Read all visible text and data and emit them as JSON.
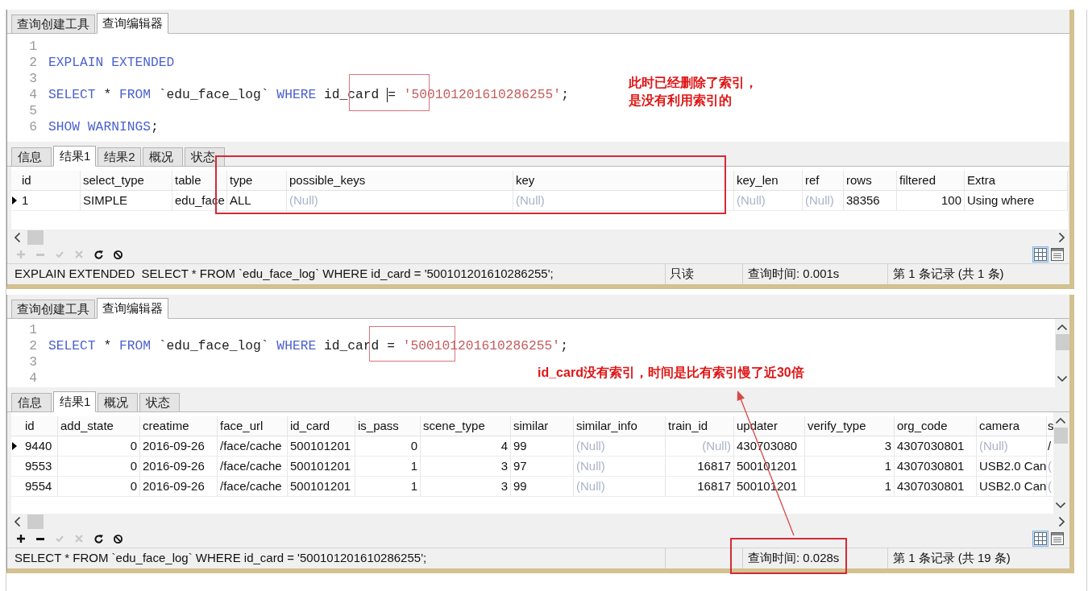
{
  "panes": [
    {
      "editor_tabs": [
        {
          "label": "查询创建工具",
          "selected": false
        },
        {
          "label": "查询编辑器",
          "selected": true
        }
      ],
      "code_lines": [
        {
          "number": "1"
        },
        {
          "number": "2",
          "tokens": [
            {
              "kind": "keyword",
              "text": "EXPLAIN EXTENDED"
            }
          ]
        },
        {
          "number": "3"
        },
        {
          "number": "4",
          "tokens": [
            {
              "kind": "keyword",
              "text": "SELECT"
            },
            {
              "kind": "plain",
              "text": " * "
            },
            {
              "kind": "keyword",
              "text": "FROM"
            },
            {
              "kind": "plain",
              "text": " `edu_face_log` "
            },
            {
              "kind": "keyword",
              "text": "WHERE"
            },
            {
              "kind": "plain",
              "text": " id_card "
            },
            {
              "kind": "caret"
            },
            {
              "kind": "plain",
              "text": "= "
            },
            {
              "kind": "string",
              "text": "'500101201610286255'"
            },
            {
              "kind": "plain",
              "text": ";"
            }
          ]
        },
        {
          "number": "5"
        },
        {
          "number": "6",
          "tokens": [
            {
              "kind": "keyword",
              "text": "SHOW WARNINGS"
            },
            {
              "kind": "plain",
              "text": ";"
            }
          ]
        }
      ],
      "editor_scrollbar": false,
      "annotation": {
        "lines": [
          "此时已经删除了索引，",
          "是没有利用索引的"
        ]
      },
      "result_tabs": [
        {
          "label": "信息",
          "selected": false
        },
        {
          "label": "结果1",
          "selected": true
        },
        {
          "label": "结果2",
          "selected": false
        },
        {
          "label": "概况",
          "selected": false
        },
        {
          "label": "状态",
          "selected": false
        }
      ],
      "table": {
        "columns": [
          {
            "label": "id",
            "kind": "text"
          },
          {
            "label": "select_type",
            "kind": "text"
          },
          {
            "label": "table",
            "kind": "text"
          },
          {
            "label": "type",
            "kind": "text"
          },
          {
            "label": "possible_keys",
            "kind": "text"
          },
          {
            "label": "key",
            "kind": "text"
          },
          {
            "label": "key_len",
            "kind": "text"
          },
          {
            "label": "ref",
            "kind": "text"
          },
          {
            "label": "rows",
            "kind": "text"
          },
          {
            "label": "filtered",
            "kind": "number"
          },
          {
            "label": "Extra",
            "kind": "text"
          }
        ],
        "rows": [
          {
            "selected": true,
            "cells": [
              {
                "text": "1",
                "null": false
              },
              {
                "text": "SIMPLE",
                "null": false
              },
              {
                "text": "edu_face",
                "null": false
              },
              {
                "text": "ALL",
                "null": false
              },
              {
                "text": "(Null)",
                "null": true
              },
              {
                "text": "(Null)",
                "null": true
              },
              {
                "text": "(Null)",
                "null": true
              },
              {
                "text": "(Null)",
                "null": true
              },
              {
                "text": "38356",
                "null": false
              },
              {
                "text": "100",
                "null": false
              },
              {
                "text": "Using where",
                "null": false
              }
            ]
          }
        ]
      },
      "table_scrollbar": false,
      "toolbar": [
        {
          "kind": "add",
          "disabled": true
        },
        {
          "kind": "remove",
          "disabled": true
        },
        {
          "kind": "apply",
          "disabled": true
        },
        {
          "kind": "discard",
          "disabled": true
        },
        {
          "kind": "refresh",
          "disabled": false
        },
        {
          "kind": "stop",
          "disabled": false
        }
      ],
      "view_toggles": [
        {
          "kind": "grid",
          "selected": true
        },
        {
          "kind": "form",
          "selected": false
        }
      ],
      "status_bar": {
        "sql": "EXPLAIN EXTENDED  SELECT * FROM `edu_face_log` WHERE id_card = '500101201610286255';",
        "mode": "只读",
        "query_time": "查询时间: 0.001s",
        "record": "第 1 条记录 (共 1 条)"
      }
    },
    {
      "editor_tabs": [
        {
          "label": "查询创建工具",
          "selected": false
        },
        {
          "label": "查询编辑器",
          "selected": true
        }
      ],
      "code_lines": [
        {
          "number": "1"
        },
        {
          "number": "2",
          "tokens": [
            {
              "kind": "keyword",
              "text": "SELECT"
            },
            {
              "kind": "plain",
              "text": " * "
            },
            {
              "kind": "keyword",
              "text": "FROM"
            },
            {
              "kind": "plain",
              "text": " `edu_face_log` "
            },
            {
              "kind": "keyword",
              "text": "WHERE"
            },
            {
              "kind": "plain",
              "text": " id_card = "
            },
            {
              "kind": "string",
              "text": "'500101201610286255'"
            },
            {
              "kind": "plain",
              "text": ";"
            }
          ]
        },
        {
          "number": "3"
        },
        {
          "number": "4"
        }
      ],
      "editor_scrollbar": true,
      "annotation": {
        "lines": [
          "id_card没有索引，时间是比有索引慢了近30倍"
        ]
      },
      "result_tabs": [
        {
          "label": "信息",
          "selected": false
        },
        {
          "label": "结果1",
          "selected": true
        },
        {
          "label": "概况",
          "selected": false
        },
        {
          "label": "状态",
          "selected": false
        }
      ],
      "table": {
        "columns": [
          {
            "label": "id",
            "kind": "text"
          },
          {
            "label": "add_state",
            "kind": "number"
          },
          {
            "label": "creatime",
            "kind": "text"
          },
          {
            "label": "face_url",
            "kind": "text"
          },
          {
            "label": "id_card",
            "kind": "text"
          },
          {
            "label": "is_pass",
            "kind": "number"
          },
          {
            "label": "scene_type",
            "kind": "number"
          },
          {
            "label": "similar",
            "kind": "text"
          },
          {
            "label": "similar_info",
            "kind": "text"
          },
          {
            "label": "train_id",
            "kind": "number"
          },
          {
            "label": "updater",
            "kind": "text"
          },
          {
            "label": "verify_type",
            "kind": "number"
          },
          {
            "label": "org_code",
            "kind": "text"
          },
          {
            "label": "camera",
            "kind": "text"
          },
          {
            "label": "s",
            "kind": "text"
          }
        ],
        "rows": [
          {
            "selected": true,
            "cells": [
              {
                "text": "9440",
                "null": false
              },
              {
                "text": "0",
                "null": false
              },
              {
                "text": "2016-09-26",
                "null": false
              },
              {
                "text": "/face/cache",
                "null": false
              },
              {
                "text": "500101201",
                "null": false
              },
              {
                "text": "0",
                "null": false
              },
              {
                "text": "4",
                "null": false
              },
              {
                "text": "99",
                "null": false
              },
              {
                "text": "(Null)",
                "null": true
              },
              {
                "text": "(Null)",
                "null": true
              },
              {
                "text": "430703080",
                "null": false
              },
              {
                "text": "3",
                "null": false
              },
              {
                "text": "4307030801",
                "null": false
              },
              {
                "text": "(Null)",
                "null": true
              },
              {
                "text": "/",
                "null": false
              }
            ]
          },
          {
            "selected": false,
            "cells": [
              {
                "text": "9553",
                "null": false
              },
              {
                "text": "0",
                "null": false
              },
              {
                "text": "2016-09-26",
                "null": false
              },
              {
                "text": "/face/cache",
                "null": false
              },
              {
                "text": "500101201",
                "null": false
              },
              {
                "text": "1",
                "null": false
              },
              {
                "text": "3",
                "null": false
              },
              {
                "text": "97",
                "null": false
              },
              {
                "text": "(Null)",
                "null": true
              },
              {
                "text": "16817",
                "null": false
              },
              {
                "text": "500101201",
                "null": false
              },
              {
                "text": "1",
                "null": false
              },
              {
                "text": "4307030801",
                "null": false
              },
              {
                "text": "USB2.0 Can",
                "null": false
              },
              {
                "text": "(",
                "null": true
              }
            ]
          },
          {
            "selected": false,
            "cells": [
              {
                "text": "9554",
                "null": false
              },
              {
                "text": "0",
                "null": false
              },
              {
                "text": "2016-09-26",
                "null": false
              },
              {
                "text": "/face/cache",
                "null": false
              },
              {
                "text": "500101201",
                "null": false
              },
              {
                "text": "1",
                "null": false
              },
              {
                "text": "3",
                "null": false
              },
              {
                "text": "99",
                "null": false
              },
              {
                "text": "(Null)",
                "null": true
              },
              {
                "text": "16817",
                "null": false
              },
              {
                "text": "500101201",
                "null": false
              },
              {
                "text": "1",
                "null": false
              },
              {
                "text": "4307030801",
                "null": false
              },
              {
                "text": "USB2.0 Can",
                "null": false
              },
              {
                "text": "(",
                "null": true
              }
            ]
          }
        ]
      },
      "table_scrollbar": true,
      "toolbar": [
        {
          "kind": "add",
          "disabled": false
        },
        {
          "kind": "remove",
          "disabled": false
        },
        {
          "kind": "apply",
          "disabled": true
        },
        {
          "kind": "discard",
          "disabled": true
        },
        {
          "kind": "refresh",
          "disabled": false
        },
        {
          "kind": "stop",
          "disabled": false
        }
      ],
      "view_toggles": [
        {
          "kind": "grid",
          "selected": true
        },
        {
          "kind": "form",
          "selected": false
        }
      ],
      "status_bar": {
        "sql": "SELECT * FROM `edu_face_log` WHERE id_card = '500101201610286255';",
        "query_time": "查询时间: 0.028s",
        "record": "第 1 条记录 (共 19 条)"
      }
    }
  ]
}
